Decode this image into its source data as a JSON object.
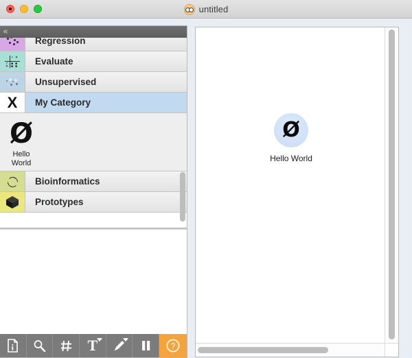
{
  "window": {
    "title": "untitled",
    "title_icon": "nerd-face-icon",
    "traffic_lights": [
      "close",
      "minimize",
      "zoom"
    ]
  },
  "dock": {
    "collapse_label": "«",
    "categories": [
      {
        "label": "Regression",
        "icon": "scatter-dots-icon",
        "selected": false,
        "clipped": true
      },
      {
        "label": "Evaluate",
        "icon": "confusion-grid-icon",
        "selected": false,
        "clipped": false
      },
      {
        "label": "Unsupervised",
        "icon": "cluster-dots-icon",
        "selected": false,
        "clipped": false
      },
      {
        "label": "My Category",
        "icon": "letter-x-icon",
        "selected": true,
        "clipped": false
      },
      {
        "label": "Bioinformatics",
        "icon": "dna-helix-icon",
        "selected": false,
        "clipped": false
      },
      {
        "label": "Prototypes",
        "icon": "cube-box-icon",
        "selected": false,
        "clipped": false
      }
    ],
    "widgets": [
      {
        "name": "Hello\nWorld",
        "name_line1": "Hello",
        "name_line2": "World",
        "glyph": "Ø"
      }
    ],
    "toolbar": [
      {
        "name": "info-document-icon",
        "label": "",
        "has_caret": false,
        "accent": false
      },
      {
        "name": "search-icon",
        "label": "",
        "has_caret": false,
        "accent": false
      },
      {
        "name": "grid-hash-icon",
        "label": "",
        "has_caret": false,
        "accent": false
      },
      {
        "name": "text-tool-icon",
        "label": "T",
        "has_caret": true,
        "accent": false
      },
      {
        "name": "pencil-tool-icon",
        "label": "",
        "has_caret": true,
        "accent": false
      },
      {
        "name": "pause-icon",
        "label": "",
        "has_caret": false,
        "accent": false
      },
      {
        "name": "help-question-icon",
        "label": "?",
        "has_caret": false,
        "accent": true
      }
    ],
    "accent_color": "#f5a33c"
  },
  "canvas": {
    "nodes": [
      {
        "label": "Hello World",
        "glyph": "Ø",
        "circle_color": "#cfe0f7"
      }
    ]
  }
}
